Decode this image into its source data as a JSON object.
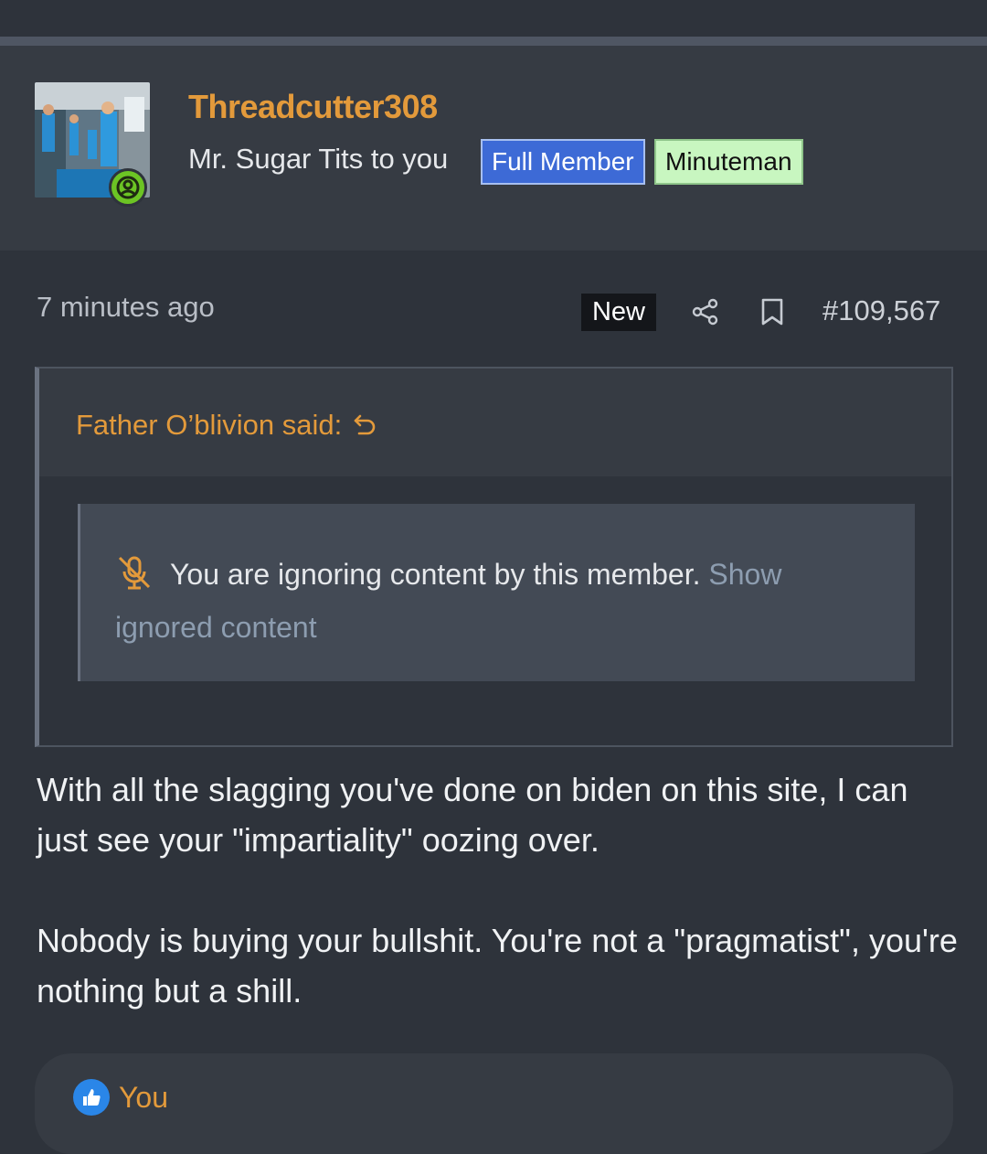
{
  "post": {
    "username": "Threadcutter308",
    "user_title": "Mr. Sugar Tits to you",
    "badges": [
      "Full Member",
      "Minuteman"
    ],
    "time": "7 minutes ago",
    "new_label": "New",
    "post_number": "#109,567",
    "quote": {
      "author": "Father O’blivion said:",
      "ignored_text": "You are ignoring content by this member.",
      "show_link": "Show ignored content"
    },
    "body": [
      "With all the slagging you've done on biden on this site, I can just see your \"impartiality\" oozing over.",
      "Nobody is buying your bullshit. You're not a \"pragmatist\", you're nothing but a shill."
    ],
    "reaction": {
      "icon": "thumbs-up-icon",
      "label": "You"
    }
  },
  "colors": {
    "username": "#e39a3b",
    "full_member_badge": "#3d6ad6",
    "minuteman_badge": "#c8f6c0",
    "online_status": "#6cc424",
    "like": "#2a86e8"
  }
}
